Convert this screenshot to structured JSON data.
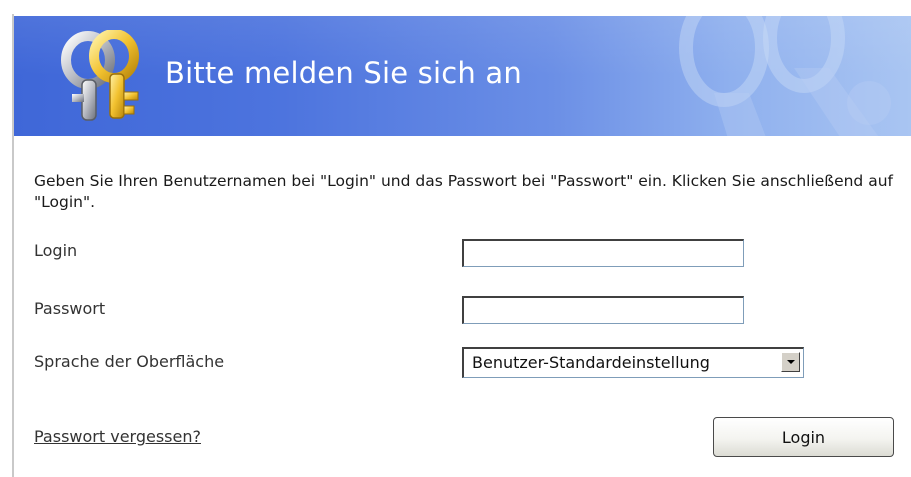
{
  "header": {
    "title": "Bitte melden Sie sich an",
    "icon": "keys-icon",
    "background_colors": [
      "#3f67d8",
      "#a9c5f2"
    ]
  },
  "form": {
    "instructions": "Geben Sie Ihren Benutzernamen bei \"Login\" und das Passwort bei \"Passwort\" ein. Klicken Sie anschließend auf \"Login\".",
    "login_label": "Login",
    "login_value": "",
    "password_label": "Passwort",
    "password_value": "",
    "language_label": "Sprache der Oberfläche",
    "language_selected": "Benutzer-Standardeinstellung",
    "forgot_link": "Passwort vergessen?",
    "submit_label": "Login"
  }
}
